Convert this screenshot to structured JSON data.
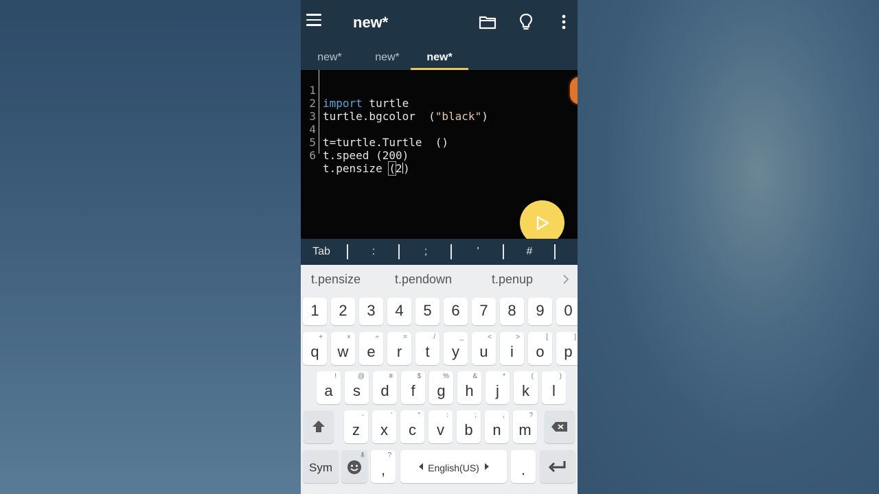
{
  "app": {
    "title": "new*"
  },
  "tabs": [
    {
      "label": "new*",
      "active": false
    },
    {
      "label": "new*",
      "active": false
    },
    {
      "label": "new*",
      "active": true
    }
  ],
  "editor": {
    "lines": [
      {
        "num": "1",
        "kw": "import",
        "rest": " turtle"
      },
      {
        "num": "2",
        "pre": "turtle.bgcolor  (",
        "str": "\"black\"",
        "post": ")"
      },
      {
        "num": "3",
        "text": ""
      },
      {
        "num": "4",
        "text": "t=turtle.Turtle  ()"
      },
      {
        "num": "5",
        "text": "t.speed (200)"
      },
      {
        "num": "6",
        "pre": "t.pensize ",
        "open": "(",
        "val": "2",
        "close": ")"
      }
    ]
  },
  "symbols": [
    "Tab",
    ":",
    ";",
    "'",
    "#"
  ],
  "suggestions": [
    "t.pensize",
    "t.pendown",
    "t.penup"
  ],
  "keyboard": {
    "numbers": [
      "1",
      "2",
      "3",
      "4",
      "5",
      "6",
      "7",
      "8",
      "9",
      "0"
    ],
    "row1": [
      {
        "k": "q",
        "s": "+"
      },
      {
        "k": "w",
        "s": "×"
      },
      {
        "k": "e",
        "s": "÷"
      },
      {
        "k": "r",
        "s": "="
      },
      {
        "k": "t",
        "s": "/"
      },
      {
        "k": "y",
        "s": "_"
      },
      {
        "k": "u",
        "s": "<"
      },
      {
        "k": "i",
        "s": ">"
      },
      {
        "k": "o",
        "s": "["
      },
      {
        "k": "p",
        "s": "]"
      }
    ],
    "row2": [
      {
        "k": "a",
        "s": "!"
      },
      {
        "k": "s",
        "s": "@"
      },
      {
        "k": "d",
        "s": "#"
      },
      {
        "k": "f",
        "s": "$"
      },
      {
        "k": "g",
        "s": "%"
      },
      {
        "k": "h",
        "s": "&"
      },
      {
        "k": "j",
        "s": "*"
      },
      {
        "k": "k",
        "s": "("
      },
      {
        "k": "l",
        "s": ")"
      }
    ],
    "row3": [
      {
        "k": "z",
        "s": "-"
      },
      {
        "k": "x",
        "s": "'"
      },
      {
        "k": "c",
        "s": "\""
      },
      {
        "k": "v",
        "s": ":"
      },
      {
        "k": "b",
        "s": ";"
      },
      {
        "k": "n",
        "s": ","
      },
      {
        "k": "m",
        "s": "?"
      }
    ],
    "sym_label": "Sym",
    "comma": ",",
    "comma_sub": "?",
    "language": "English(US)",
    "period": "."
  },
  "colors": {
    "appbar": "#1f3445",
    "tab_indicator": "#f5c842",
    "run_fab": "#f7d65a",
    "keyword": "#5aa7d8",
    "string": "#e8c8a8"
  }
}
